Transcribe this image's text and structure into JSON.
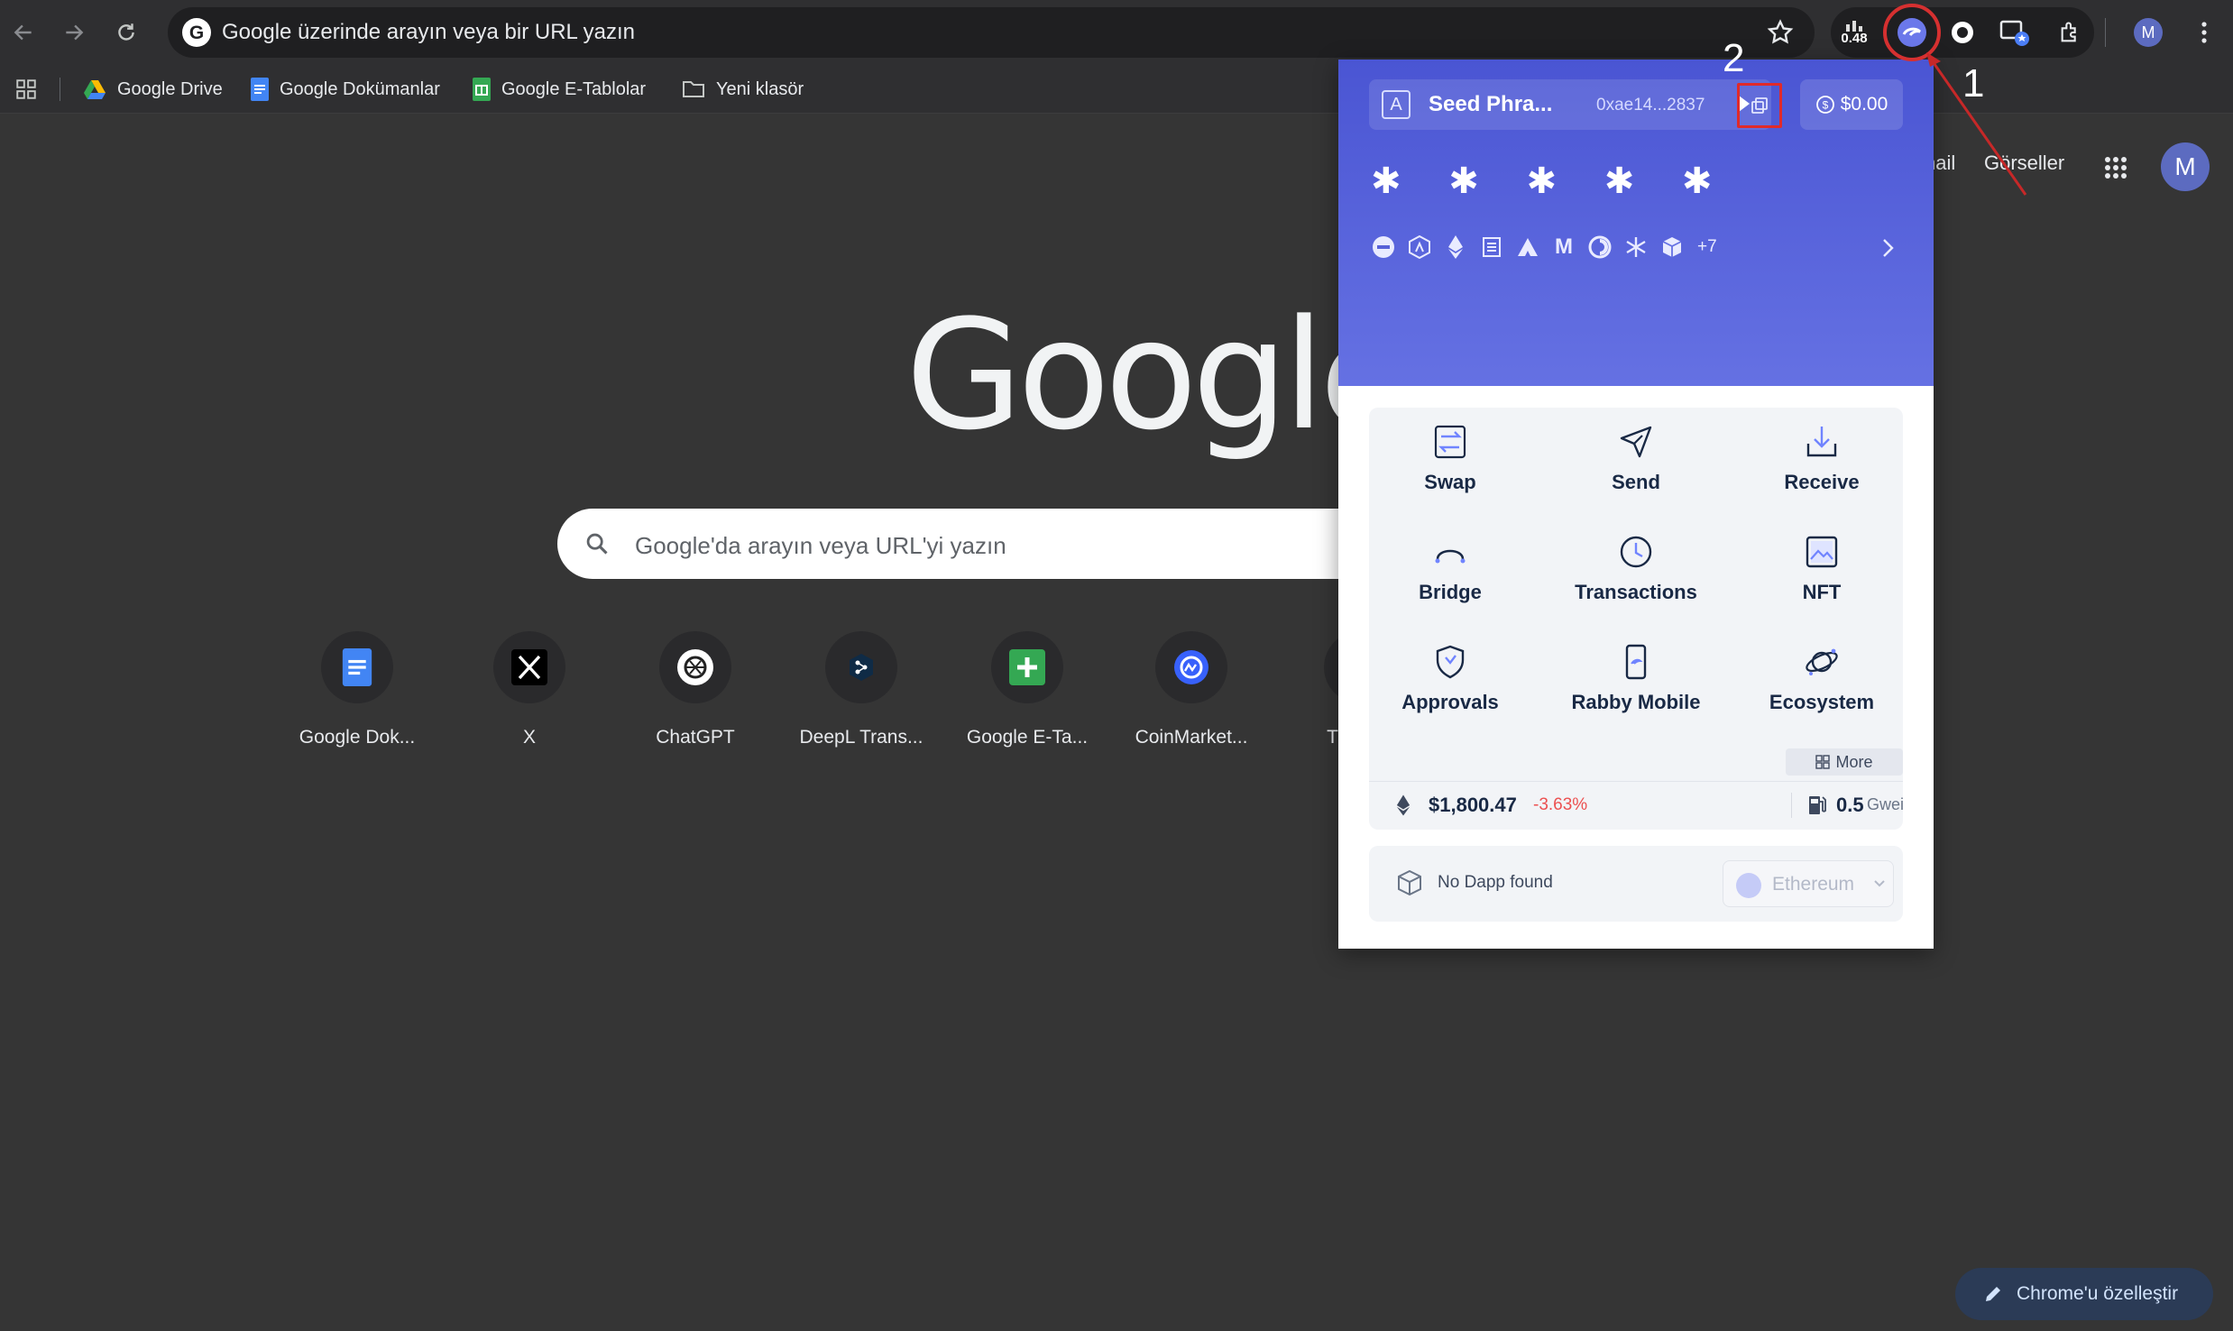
{
  "browser": {
    "omnibox_text": "Google üzerinde arayın veya bir URL yazın",
    "extensions": {
      "first_badge": "0.48"
    },
    "profile_initial": "M",
    "bookmarks": [
      {
        "label": "Google Drive",
        "icon": "drive-icon"
      },
      {
        "label": "Google Dokümanlar",
        "icon": "docs-icon"
      },
      {
        "label": "Google E-Tablolar",
        "icon": "sheets-icon"
      },
      {
        "label": "Yeni klasör",
        "icon": "folder-icon"
      }
    ]
  },
  "google_page": {
    "header_links": [
      "nail",
      "Görseller"
    ],
    "avatar_initial": "M",
    "logo_text": "Google",
    "search_placeholder": "Google'da arayın veya URL'yi yazın",
    "shortcuts": [
      {
        "label": "Google Dok...",
        "icon": "docs-icon"
      },
      {
        "label": "X",
        "icon": "x-logo-icon"
      },
      {
        "label": "ChatGPT",
        "icon": "chatgpt-icon"
      },
      {
        "label": "DeepL Trans...",
        "icon": "deepl-icon"
      },
      {
        "label": "Google E-Ta...",
        "icon": "sheets-icon"
      },
      {
        "label": "CoinMarket...",
        "icon": "coinmarketcap-icon"
      },
      {
        "label": "T",
        "icon": "partial-shortcut-icon"
      }
    ],
    "customize_label": "Chrome'u özelleştir"
  },
  "rabby_popup": {
    "account": {
      "icon_letter": "A",
      "name": "Seed Phra...",
      "address": "0xae14...2837"
    },
    "balance": "$0.00",
    "hidden_balance": "✱ ✱ ✱ ✱ ✱",
    "chains": [
      "minus-icon",
      "arbitrum-icon",
      "ethereum-icon",
      "chain-icon",
      "avalanche-icon",
      "M",
      "celo-icon",
      "snowflake-icon",
      "cube-icon"
    ],
    "chains_more": "+7",
    "actions": [
      {
        "label": "Swap",
        "icon": "swap-icon"
      },
      {
        "label": "Send",
        "icon": "send-icon"
      },
      {
        "label": "Receive",
        "icon": "receive-icon"
      },
      {
        "label": "Bridge",
        "icon": "bridge-icon"
      },
      {
        "label": "Transactions",
        "icon": "clock-icon"
      },
      {
        "label": "NFT",
        "icon": "nft-icon"
      },
      {
        "label": "Approvals",
        "icon": "shield-icon"
      },
      {
        "label": "Rabby Mobile",
        "icon": "phone-icon"
      },
      {
        "label": "Ecosystem",
        "icon": "planet-icon"
      }
    ],
    "more_label": "More",
    "eth_price": "$1,800.47",
    "eth_change": "-3.63%",
    "gas_value": "0.5",
    "gas_unit": "Gwei",
    "dapp_status": "No Dapp found",
    "chain_selector": "Ethereum"
  },
  "annotations": {
    "step_1": "1",
    "step_2": "2"
  },
  "colors": {
    "popup_accent": "#4a55d3",
    "annotation_red": "#d63030",
    "negative_change": "#ec5151"
  }
}
